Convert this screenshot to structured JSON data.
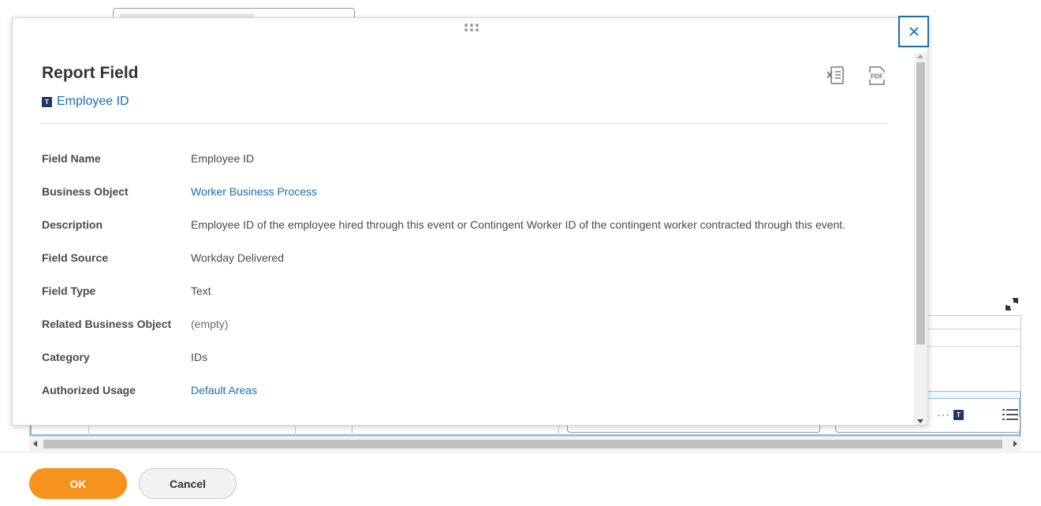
{
  "popup": {
    "title": "Report Field",
    "subtitle_chip": "T",
    "subtitle_link": "Employee ID",
    "fields": [
      {
        "label": "Field Name",
        "value": "Employee ID"
      },
      {
        "label": "Business Object",
        "value": "Worker Business Process"
      },
      {
        "label": "Description",
        "value": "Employee ID of the employee hired through this event or Contingent Worker ID of the contingent worker contracted through this event."
      },
      {
        "label": "Field Source",
        "value": "Workday Delivered"
      },
      {
        "label": "Field Type",
        "value": "Text"
      },
      {
        "label": "Related Business Object",
        "value": "(empty)"
      },
      {
        "label": "Category",
        "value": "IDs"
      },
      {
        "label": "Authorized Usage",
        "value": "Default Areas"
      }
    ]
  },
  "grid": {
    "row_chip": "T"
  },
  "footer": {
    "ok_label": "OK",
    "cancel_label": "Cancel"
  },
  "colors": {
    "accent_orange": "#f6921e",
    "link_blue": "#1a6fb3",
    "chip_navy": "#1f3a66"
  }
}
